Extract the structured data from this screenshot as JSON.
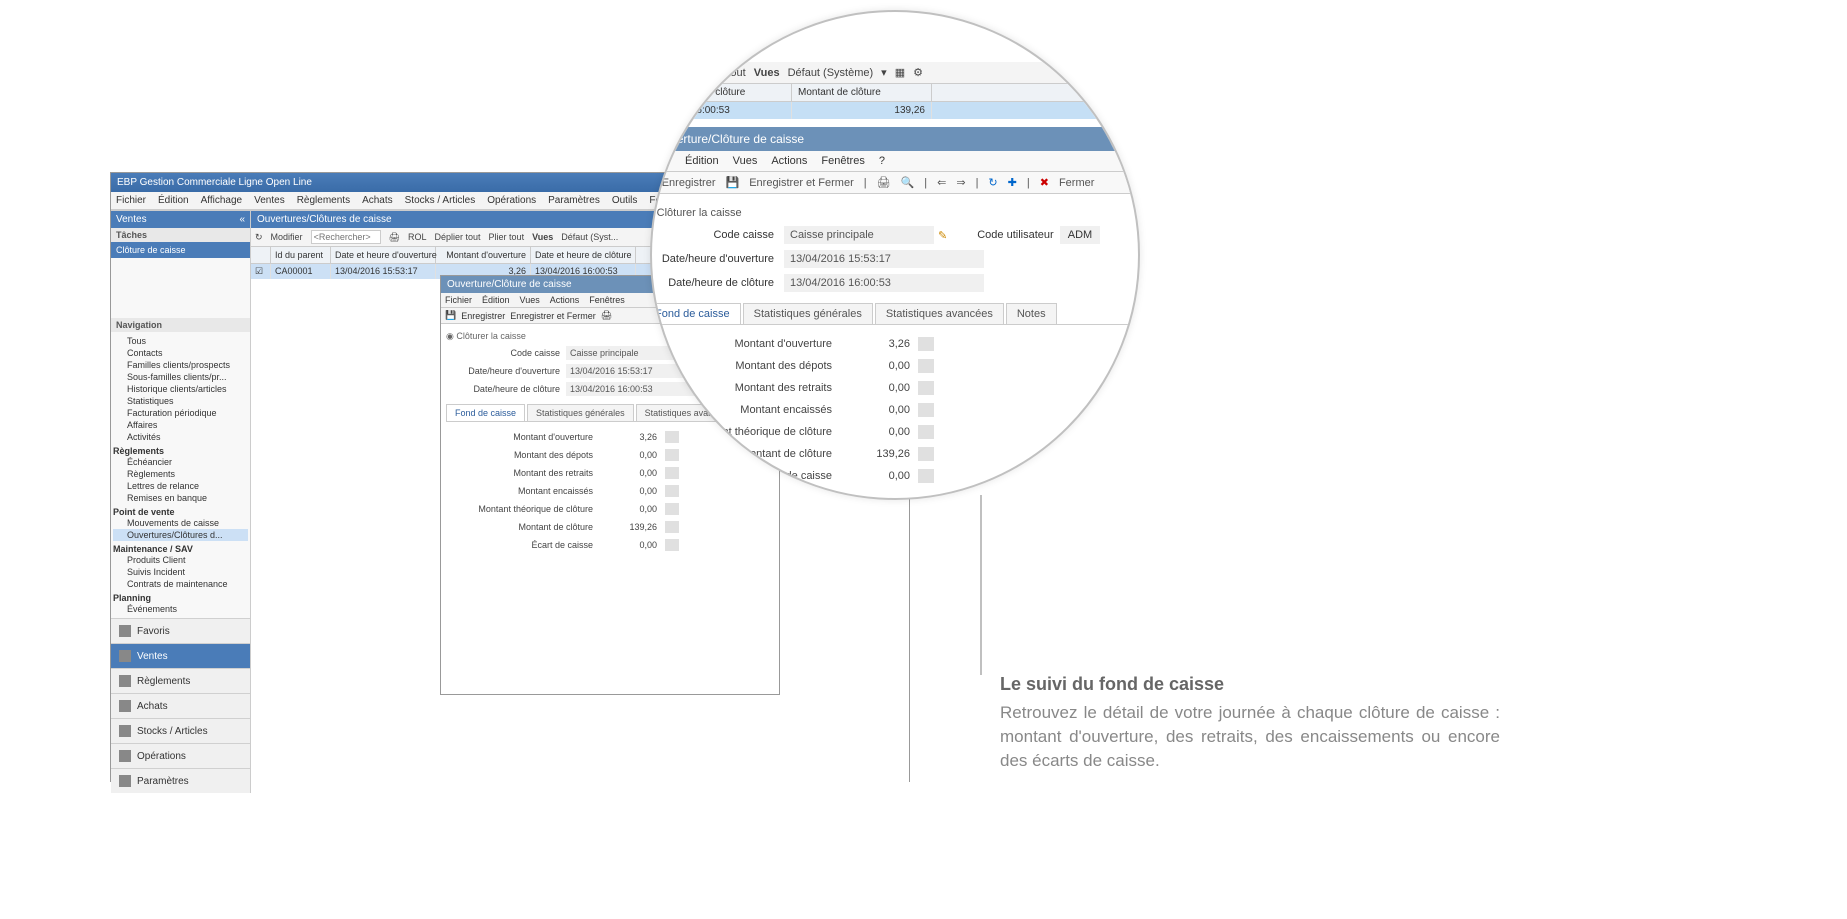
{
  "app": {
    "title": "EBP Gestion Commerciale Ligne Open Line",
    "menu": [
      "Fichier",
      "Édition",
      "Affichage",
      "Ventes",
      "Règlements",
      "Achats",
      "Stocks / Articles",
      "Opérations",
      "Paramètres",
      "Outils",
      "Fenêtres",
      "?"
    ]
  },
  "sidebar": {
    "header": "Ventes",
    "tasks_label": "Tâches",
    "task_item": "Clôture de caisse",
    "nav_label": "Navigation",
    "groups": [
      {
        "label": "",
        "items": [
          "Tous",
          "Contacts",
          "Familles clients/prospects",
          "Sous-familles clients/pr...",
          "Historique clients/articles",
          "Statistiques",
          "Facturation périodique",
          "Affaires",
          "Activités"
        ]
      },
      {
        "label": "Règlements",
        "items": [
          "Échéancier",
          "Règlements",
          "Lettres de relance",
          "Remises en banque"
        ]
      },
      {
        "label": "Point de vente",
        "items": [
          "Mouvements de caisse",
          "Ouvertures/Clôtures d..."
        ],
        "selected": 1
      },
      {
        "label": "Maintenance / SAV",
        "items": [
          "Produits Client",
          "Suivis Incident",
          "Contrats de maintenance"
        ]
      },
      {
        "label": "Planning",
        "items": [
          "Événements"
        ]
      }
    ],
    "bottom": [
      "Favoris",
      "Ventes",
      "Règlements",
      "Achats",
      "Stocks / Articles",
      "Opérations",
      "Paramètres"
    ],
    "bottom_active": 1
  },
  "panel": {
    "title": "Ouvertures/Clôtures de caisse",
    "toolbar": {
      "modifier": "Modifier",
      "search_ph": "<Rechercher>",
      "rol": "ROL",
      "deplier": "Déplier tout",
      "plier": "Plier tout",
      "vues": "Vues",
      "defaut": "Défaut (Syst..."
    },
    "columns": [
      "",
      "Id du parent",
      "Date et heure d'ouverture",
      "Montant d'ouverture",
      "Date et heure de clôture",
      "Montant de clôture"
    ],
    "row": {
      "id": "CA00001",
      "open_dt": "13/04/2016 15:53:17",
      "open_amt": "3,26",
      "close_dt": "13/04/2016 16:00:53",
      "close_amt": "139,26"
    }
  },
  "detail": {
    "title": "Ouverture/Clôture de caisse",
    "menu": [
      "Fichier",
      "Édition",
      "Vues",
      "Actions",
      "Fenêtres",
      "?"
    ],
    "tool": {
      "enreg": "Enregistrer",
      "enreg_fermer": "Enregistrer et Fermer",
      "fermer": "Fermer"
    },
    "cloturer": "Clôturer la caisse",
    "fields": {
      "code_caisse_lbl": "Code caisse",
      "code_caisse_val": "Caisse principale",
      "code_user_lbl": "Code utilisateur",
      "code_user_val": "ADM",
      "open_lbl": "Date/heure d'ouverture",
      "open_val": "13/04/2016 15:53:17",
      "close_lbl": "Date/heure de clôture",
      "close_val": "13/04/2016 16:00:53"
    },
    "tabs": [
      "Fond de caisse",
      "Statistiques générales",
      "Statistiques avancées",
      "Notes"
    ],
    "kv": [
      {
        "k": "Montant d'ouverture",
        "v": "3,26"
      },
      {
        "k": "Montant des dépots",
        "v": "0,00"
      },
      {
        "k": "Montant des retraits",
        "v": "0,00"
      },
      {
        "k": "Montant encaissés",
        "v": "0,00"
      },
      {
        "k": "Montant théorique de clôture",
        "v": "0,00"
      },
      {
        "k": "Montant de clôture",
        "v": "139,26"
      },
      {
        "k": "Écart de caisse",
        "v": "0,00"
      }
    ]
  },
  "lens_toolbar": {
    "deplier": "Déplier tout",
    "plier": "Plier tout",
    "vues": "Vues",
    "defaut": "Défaut (Système)"
  },
  "caption": {
    "title": "Le suivi du fond de caisse",
    "body": "Retrouvez le détail de votre journée à chaque clôture de caisse : montant d'ouverture, des retraits, des encaissements ou encore des écarts de caisse."
  }
}
